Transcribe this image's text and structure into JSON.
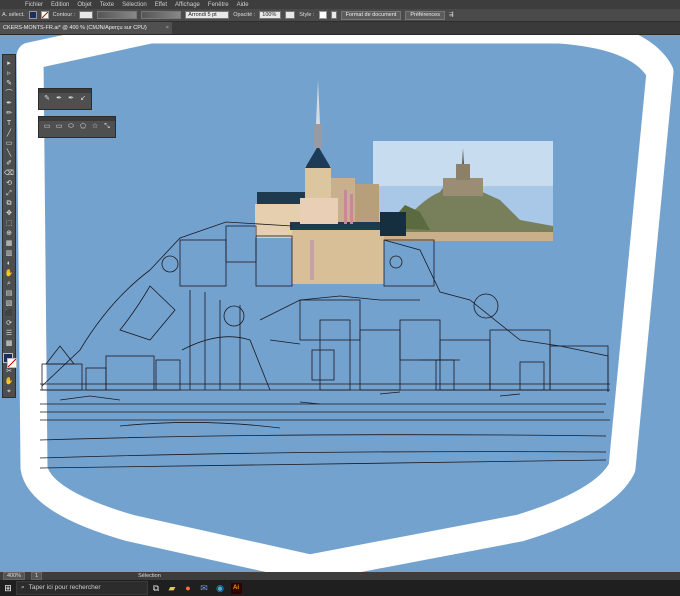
{
  "app": {
    "menu": [
      "Fichier",
      "Edition",
      "Objet",
      "Texte",
      "Sélection",
      "Effet",
      "Affichage",
      "Fenêtre",
      "Aide"
    ]
  },
  "options": {
    "selection_label": "A. sélect.",
    "stroke_label": "Contour :",
    "brush_value": "Arrondi 5 pt",
    "opacity_label": "Opacité :",
    "opacity_value": "100%",
    "style_label": "Style :",
    "doc_format_button": "Format de document",
    "prefs_button": "Préférences"
  },
  "document": {
    "tab_title": "CKERS-MONTS-FR.ai* @ 400 % (CMJN/Aperçu sur CPU)",
    "close_glyph": "×"
  },
  "toolbar": {
    "tools": [
      "▸",
      "▹",
      "✎",
      "⌒",
      "✒",
      "✏",
      "T",
      "╱",
      "▭",
      "╲",
      "✐",
      "⌫",
      "⟲",
      "⤢",
      "⧉",
      "✥",
      "⬚",
      "⊕",
      "▦",
      "▥",
      "◐",
      "✋",
      "⌕",
      "▤",
      "▧",
      "⬛",
      "⟳",
      "☰",
      "▩",
      "☷",
      "✲",
      "▣",
      "◫",
      "⊞",
      "⊡",
      "✂",
      "✋",
      "⌖",
      "⊙"
    ]
  },
  "float_panel_1": {
    "icons": [
      "✎",
      "✒",
      "✒",
      "↙"
    ]
  },
  "float_panel_2": {
    "icons": [
      "▭",
      "▭",
      "⬭",
      "⬠",
      "☆",
      "⤡"
    ]
  },
  "status": {
    "zoom": "400%",
    "page": "1",
    "mode": "Sélection"
  },
  "taskbar": {
    "search_placeholder": "Taper ici pour rechercher",
    "ai_label": "Ai"
  },
  "colors": {
    "canvas_bg": "#74a2ce",
    "artboard_frame": "#ffffff",
    "fill_color": "#1c2f5c"
  }
}
